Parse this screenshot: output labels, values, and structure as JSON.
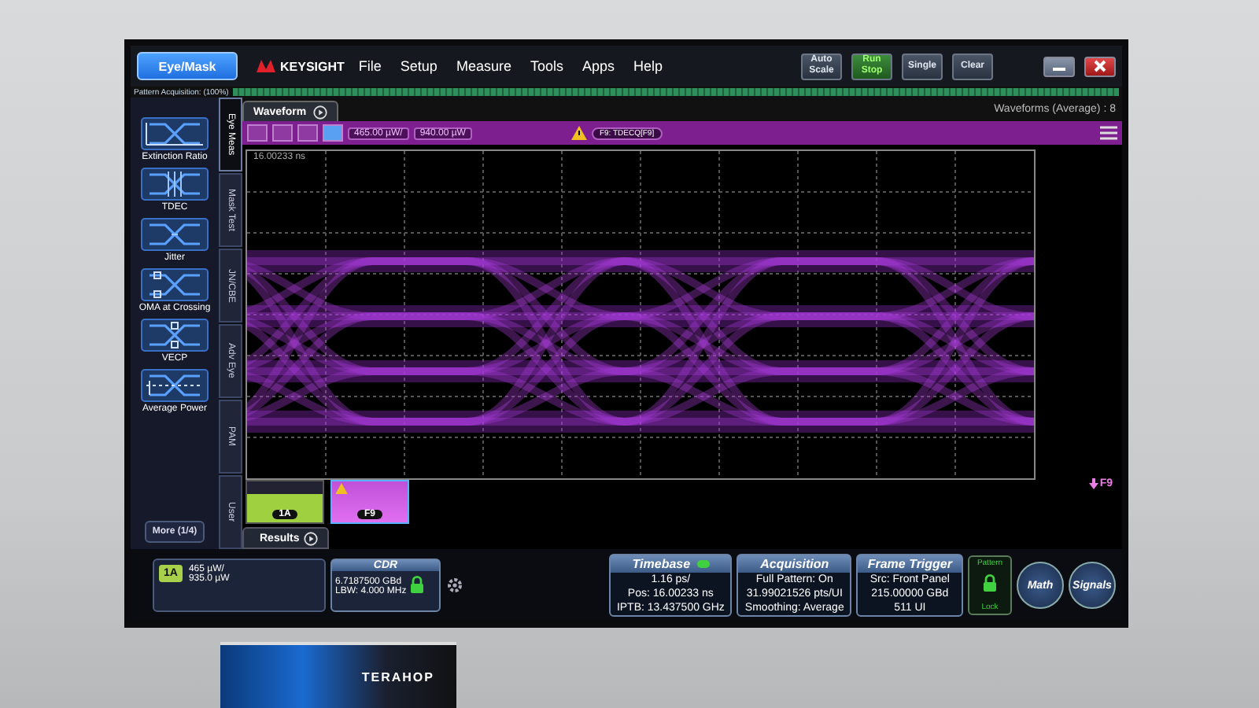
{
  "menu_bar": {
    "mode_button": "Eye/Mask",
    "brand": "KEYSIGHT",
    "menus": [
      "File",
      "Setup",
      "Measure",
      "Tools",
      "Apps",
      "Help"
    ],
    "buttons": [
      {
        "label": "Auto Scale",
        "kind": "plain"
      },
      {
        "label": "Run Stop",
        "kind": "run"
      },
      {
        "label": "Single",
        "kind": "plain"
      },
      {
        "label": "Clear",
        "kind": "plain"
      }
    ]
  },
  "acquisition_bar": {
    "label": "Pattern Acquisition: (100%)",
    "level": 1
  },
  "side_tabs": [
    {
      "label": "Eye Meas",
      "selected": true
    },
    {
      "label": "Mask Test",
      "selected": false
    },
    {
      "label": "JN/CBE",
      "selected": false
    },
    {
      "label": "Adv Eye",
      "selected": false
    },
    {
      "label": "PAM",
      "selected": false
    },
    {
      "label": "User",
      "selected": false
    }
  ],
  "measurements": [
    {
      "label": "Extinction Ratio",
      "kind": "ratio"
    },
    {
      "label": "TDEC",
      "kind": "tdec"
    },
    {
      "label": "Jitter",
      "kind": "jitter"
    },
    {
      "label": "OMA at Crossing",
      "kind": "oma"
    },
    {
      "label": "VECP",
      "kind": "vecp"
    },
    {
      "label": "Average Power",
      "kind": "power"
    }
  ],
  "more_button": "More (1/4)",
  "waveform": {
    "tab": "Waveform",
    "status": "Waveforms (Average) : 8",
    "scale": "465.00 µW/",
    "offset": "940.00 µW",
    "function_chip": "F9: TDECQ[F9]",
    "time_label": "16.00233 ns",
    "marker": "F9"
  },
  "thumbnails": [
    {
      "label": "1A",
      "selected": false,
      "warning": false
    },
    {
      "label": "F9",
      "selected": true,
      "warning": true
    }
  ],
  "results": {
    "label": "Results"
  },
  "channel": {
    "badge": "1A",
    "line_1": "465 µW/",
    "line_2": "935.0 µW"
  },
  "cdr": {
    "title": "CDR",
    "line_1": "6.7187500 GBd",
    "line_2": "LBW: 4.000 MHz",
    "locked": true
  },
  "timebase": {
    "title": "Timebase",
    "lines": [
      "1.16 ps/",
      "Pos: 16.00233 ns",
      "IPTB: 13.437500 GHz"
    ]
  },
  "acquisition": {
    "title": "Acquisition",
    "lines": [
      "Full Pattern: On",
      "31.99021526 pts/UI",
      "Smoothing: Average"
    ]
  },
  "frame_trigger": {
    "title": "Frame Trigger",
    "lines": [
      "Src: Front Panel",
      "215.00000 GBd",
      "511 UI"
    ]
  },
  "pattern_lock": {
    "top": "Pattern",
    "bottom": "Lock",
    "locked": true
  },
  "round_buttons": [
    "Math",
    "Signals"
  ],
  "banner": {
    "text": "TERAHOP"
  }
}
